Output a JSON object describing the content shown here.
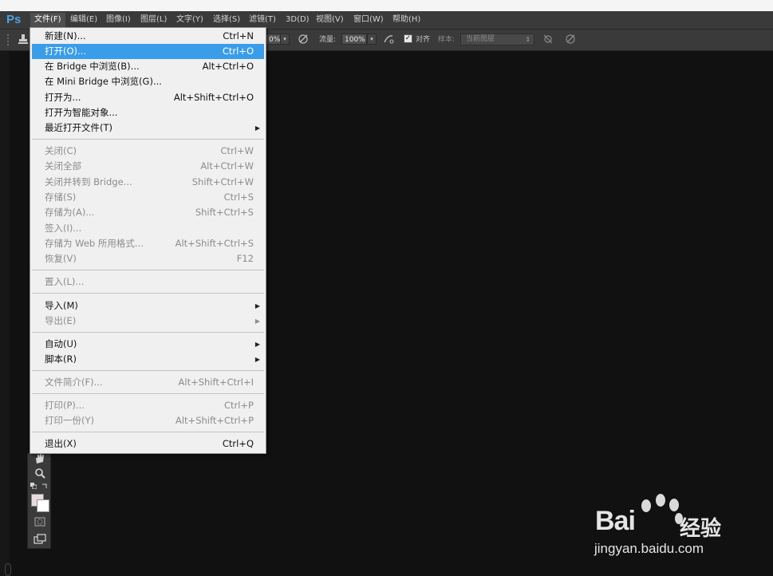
{
  "app": {
    "logo": "Ps"
  },
  "menubar": {
    "items": [
      {
        "label": "文件(F)",
        "active": true
      },
      {
        "label": "编辑(E)"
      },
      {
        "label": "图像(I)"
      },
      {
        "label": "图层(L)"
      },
      {
        "label": "文字(Y)"
      },
      {
        "label": "选择(S)"
      },
      {
        "label": "滤镜(T)"
      },
      {
        "label": "3D(D)"
      },
      {
        "label": "视图(V)"
      },
      {
        "label": "窗口(W)"
      },
      {
        "label": "帮助(H)"
      }
    ]
  },
  "options": {
    "opacity_value": "0%",
    "flow_label": "流量:",
    "flow_value": "100%",
    "align_label": "对齐",
    "align_checked": true,
    "sample_label": "样本:",
    "sample_value": "当前图层"
  },
  "file_menu": {
    "items": [
      {
        "label": "新建(N)...",
        "shortcut": "Ctrl+N"
      },
      {
        "label": "打开(O)...",
        "shortcut": "Ctrl+O",
        "highlighted": true
      },
      {
        "label": "在 Bridge 中浏览(B)...",
        "shortcut": "Alt+Ctrl+O"
      },
      {
        "label": "在 Mini Bridge 中浏览(G)...",
        "shortcut": ""
      },
      {
        "label": "打开为...",
        "shortcut": "Alt+Shift+Ctrl+O"
      },
      {
        "label": "打开为智能对象...",
        "shortcut": ""
      },
      {
        "label": "最近打开文件(T)",
        "shortcut": "",
        "submenu": true
      },
      {
        "label": "关闭(C)",
        "shortcut": "Ctrl+W",
        "disabled": true
      },
      {
        "label": "关闭全部",
        "shortcut": "Alt+Ctrl+W",
        "disabled": true
      },
      {
        "label": "关闭并转到 Bridge...",
        "shortcut": "Shift+Ctrl+W",
        "disabled": true
      },
      {
        "label": "存储(S)",
        "shortcut": "Ctrl+S",
        "disabled": true
      },
      {
        "label": "存储为(A)...",
        "shortcut": "Shift+Ctrl+S",
        "disabled": true
      },
      {
        "label": "签入(I)...",
        "shortcut": "",
        "disabled": true
      },
      {
        "label": "存储为 Web 所用格式...",
        "shortcut": "Alt+Shift+Ctrl+S",
        "disabled": true
      },
      {
        "label": "恢复(V)",
        "shortcut": "F12",
        "disabled": true
      },
      {
        "label": "置入(L)...",
        "shortcut": "",
        "disabled": true
      },
      {
        "label": "导入(M)",
        "shortcut": "",
        "submenu": true
      },
      {
        "label": "导出(E)",
        "shortcut": "",
        "submenu": true,
        "disabled": true
      },
      {
        "label": "自动(U)",
        "shortcut": "",
        "submenu": true
      },
      {
        "label": "脚本(R)",
        "shortcut": "",
        "submenu": true
      },
      {
        "label": "文件简介(F)...",
        "shortcut": "Alt+Shift+Ctrl+I",
        "disabled": true
      },
      {
        "label": "打印(P)...",
        "shortcut": "Ctrl+P",
        "disabled": true
      },
      {
        "label": "打印一份(Y)",
        "shortcut": "Alt+Shift+Ctrl+P",
        "disabled": true
      },
      {
        "label": "退出(X)",
        "shortcut": "Ctrl+Q"
      }
    ]
  },
  "watermark": {
    "brand": "Bai",
    "brand_cn": "经验",
    "url": "jingyan.baidu.com"
  },
  "colors": {
    "highlight": "#3a9dea",
    "menu_bg": "#f0f0f0",
    "canvas_bg": "#111111",
    "ps_blue": "#4aa3e0"
  }
}
